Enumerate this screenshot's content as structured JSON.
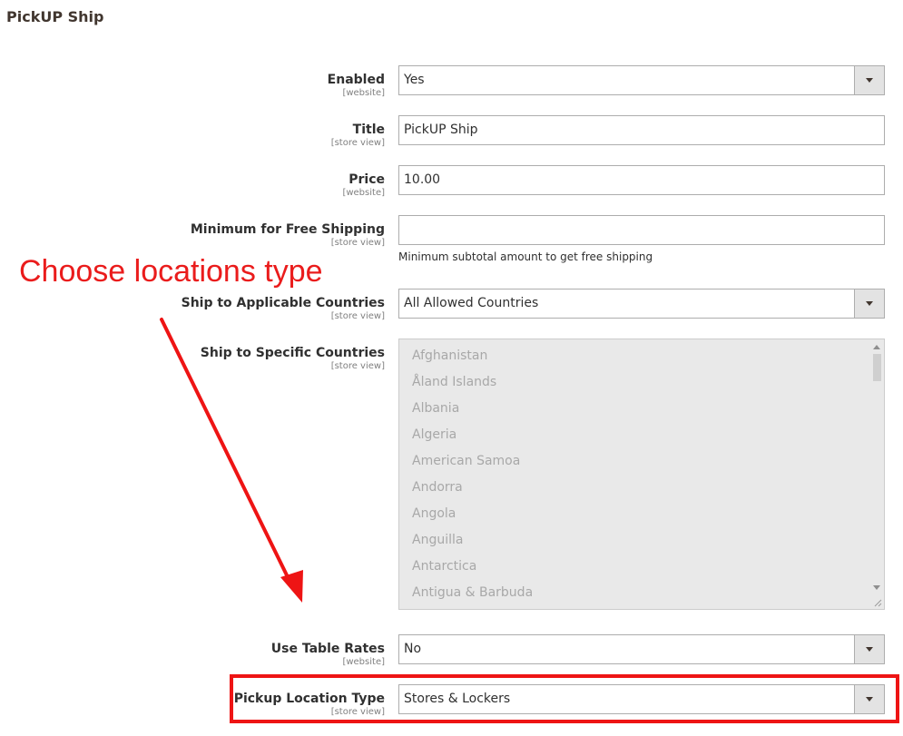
{
  "section": {
    "title": "PickUP Ship"
  },
  "fields": {
    "enabled": {
      "label": "Enabled",
      "scope": "[website]",
      "value": "Yes"
    },
    "title": {
      "label": "Title",
      "scope": "[store view]",
      "value": "PickUP Ship"
    },
    "price": {
      "label": "Price",
      "scope": "[website]",
      "value": "10.00"
    },
    "min_free_shipping": {
      "label": "Minimum for Free Shipping",
      "scope": "[store view]",
      "value": "",
      "note": "Minimum subtotal amount to get free shipping"
    },
    "applicable_countries": {
      "label": "Ship to Applicable Countries",
      "scope": "[store view]",
      "value": "All Allowed Countries"
    },
    "specific_countries": {
      "label": "Ship to Specific Countries",
      "scope": "[store view]",
      "options": [
        "Afghanistan",
        "Åland Islands",
        "Albania",
        "Algeria",
        "American Samoa",
        "Andorra",
        "Angola",
        "Anguilla",
        "Antarctica",
        "Antigua & Barbuda"
      ]
    },
    "table_rates": {
      "label": "Use Table Rates",
      "scope": "[website]",
      "value": "No"
    },
    "location_type": {
      "label": "Pickup Location Type",
      "scope": "[store view]",
      "value": "Stores & Lockers"
    }
  },
  "annotation": {
    "text": "Choose locations type",
    "color": "#ea1c1c"
  },
  "icons": {
    "select_arrow": "chevron-down-icon",
    "scroll_up": "scroll-up-icon",
    "scroll_down": "scroll-down-icon",
    "resize": "resize-grip-icon"
  }
}
